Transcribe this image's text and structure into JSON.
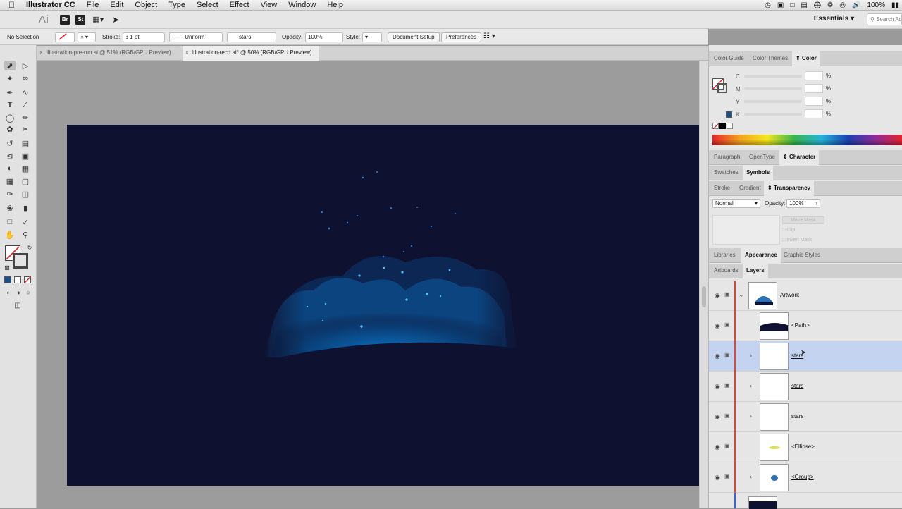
{
  "menubar": {
    "apple_icon": "apple-logo-icon",
    "app_name": "Illustrator CC",
    "items": [
      "File",
      "Edit",
      "Object",
      "Type",
      "Select",
      "Effect",
      "View",
      "Window",
      "Help"
    ],
    "battery": "100%"
  },
  "appbar": {
    "logo": "Ai",
    "bridge": "Br",
    "stock": "St",
    "workspace": "Essentials",
    "search_placeholder": "Search Ad"
  },
  "control": {
    "selection": "No Selection",
    "stroke_label": "Stroke:",
    "stroke_weight": "1 pt",
    "stroke_profile": "Uniform",
    "brush": "stars",
    "opacity_label": "Opacity:",
    "opacity_value": "100%",
    "style_label": "Style:",
    "document_setup": "Document Setup",
    "preferences": "Preferences"
  },
  "tabs": [
    {
      "label": "illustration-pre-run.ai @ 51% (RGB/GPU Preview)",
      "active": false
    },
    {
      "label": "illustration-recd.ai* @ 50% (RGB/GPU Preview)",
      "active": true
    }
  ],
  "color_panel": {
    "tabs": [
      "Color Guide",
      "Color Themes",
      "Color"
    ],
    "active_tab": "Color",
    "channels": [
      "C",
      "M",
      "Y",
      "K"
    ],
    "unit": "%"
  },
  "character_tabs": [
    "Paragraph",
    "OpenType",
    "Character"
  ],
  "swatches_tabs": [
    "Swatches",
    "Symbols"
  ],
  "transparency": {
    "tabs": [
      "Stroke",
      "Gradient",
      "Transparency"
    ],
    "blend_mode": "Normal",
    "opacity_label": "Opacity:",
    "opacity_value": "100%",
    "make_mask": "Make Mask",
    "clip": "Clip",
    "invert_mask": "Invert Mask"
  },
  "appearance_tabs": [
    "Libraries",
    "Appearance",
    "Graphic Styles"
  ],
  "layers_tabs": [
    "Artboards",
    "Layers"
  ],
  "layers": [
    {
      "name": "Artwork",
      "level": 0,
      "expanded": true,
      "selected": false,
      "underline": false
    },
    {
      "name": "<Path>",
      "level": 1,
      "expanded": false,
      "selected": false,
      "underline": false
    },
    {
      "name": "stars",
      "level": 1,
      "expanded": false,
      "selected": true,
      "underline": true
    },
    {
      "name": "stars",
      "level": 1,
      "expanded": false,
      "selected": false,
      "underline": true
    },
    {
      "name": "stars",
      "level": 1,
      "expanded": false,
      "selected": false,
      "underline": true
    },
    {
      "name": "<Ellipse>",
      "level": 1,
      "expanded": false,
      "selected": false,
      "underline": false
    },
    {
      "name": "<Group>",
      "level": 1,
      "expanded": false,
      "selected": false,
      "underline": true
    }
  ],
  "colors": {
    "artboard": "#0e1230",
    "layer_color": "#e0443d",
    "selection_row": "#c4d3ef",
    "cloud_glow": "#0b5a9e"
  }
}
